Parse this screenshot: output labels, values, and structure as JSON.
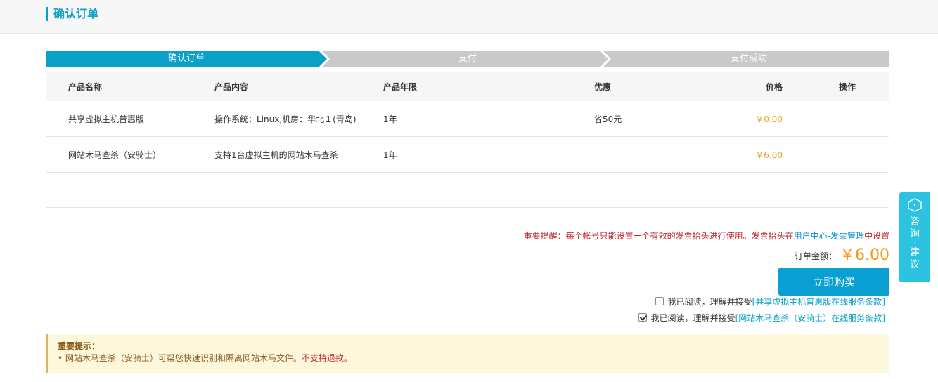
{
  "page": {
    "title": "确认订单"
  },
  "steps": [
    {
      "label": "确认订单",
      "active": true
    },
    {
      "label": "支付",
      "active": false
    },
    {
      "label": "支付成功",
      "active": false
    }
  ],
  "table": {
    "headers": [
      "产品名称",
      "产品内容",
      "产品年限",
      "优惠",
      "价格",
      "操作"
    ],
    "rows": [
      {
        "name": "共享虚拟主机普惠版",
        "content": "操作系统：Linux,机房：华北１(青岛)",
        "term": "1年",
        "discount": "省50元",
        "price": "￥0.00"
      },
      {
        "name": "网站木马查杀（安骑士）",
        "content": "支持1台虚拟主机的网站木马查杀",
        "term": "1年",
        "discount": "",
        "price": "￥6.00"
      }
    ]
  },
  "reminder": {
    "prefix": "重要提醒：每个帐号只能设置一个有效的发票抬头进行使用。发票抬头在",
    "link": "用户中心-发票管理",
    "suffix": "中设置"
  },
  "total": {
    "label": "订单金额：",
    "value": "￥6.00"
  },
  "buy_button": {
    "label": "立即购买"
  },
  "agreements": [
    {
      "text": "我已阅读，理解并接受",
      "link": "[共享虚拟主机普惠版在线服务条款]",
      "checked": false
    },
    {
      "text": "我已阅读，理解并接受",
      "link": "[网站木马查杀（安骑士）在线服务条款]",
      "checked": true
    }
  ],
  "notice": {
    "title": "重要提示：",
    "line_text": "• 网站木马查杀（安骑士）可帮您快速识别和隔离网站木马文件。",
    "line_warn": "不支持退款。"
  },
  "side_widget": {
    "char1": "咨",
    "char2": "询",
    "sep": "·",
    "char3": "建",
    "char4": "议",
    "icon": "hexagon-icon"
  },
  "colors": {
    "accent": "#0aa0c8",
    "price": "#e6a01e",
    "total": "#f39c1c",
    "warning": "#c0282d",
    "step_inactive": "#c9c9c9"
  }
}
